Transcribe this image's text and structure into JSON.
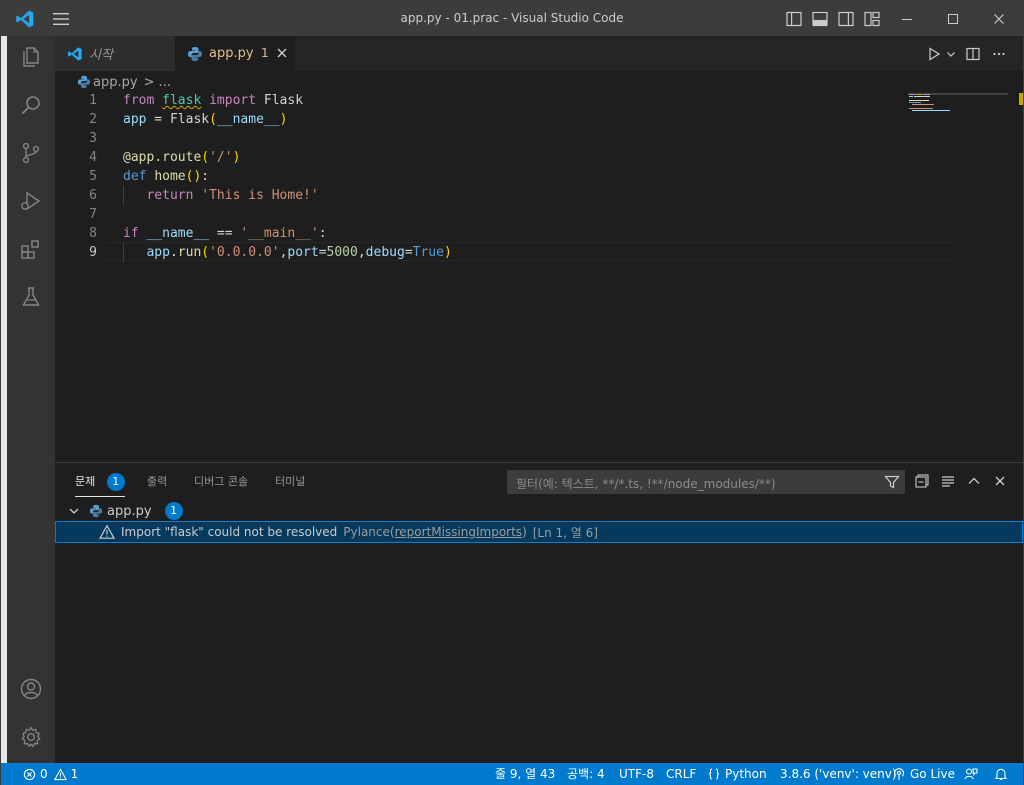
{
  "window": {
    "title": "app.py - 01.prac - Visual Studio Code"
  },
  "tabs": [
    {
      "label": "시작",
      "icon": "vscode-logo-icon"
    },
    {
      "label": "app.py",
      "icon": "python-icon",
      "problem_count": "1"
    }
  ],
  "breadcrumb": {
    "file": "app.py",
    "separator": ">",
    "more": "..."
  },
  "editor": {
    "current_line": 9,
    "lines": [
      {
        "no": "1"
      },
      {
        "no": "2"
      },
      {
        "no": "3"
      },
      {
        "no": "4"
      },
      {
        "no": "5"
      },
      {
        "no": "6"
      },
      {
        "no": "7"
      },
      {
        "no": "8"
      },
      {
        "no": "9"
      }
    ],
    "code": {
      "l1": {
        "from": "from",
        "module": "flask",
        "import": "import",
        "cls": "Flask"
      },
      "l2": {
        "var": "app",
        "eq": " = ",
        "cls": "Flask",
        "open": "(",
        "arg": "__name__",
        "close": ")"
      },
      "l4": {
        "at": "@",
        "obj": "app",
        "dot": ".",
        "fn": "route",
        "open": "(",
        "str": "'/'",
        "close": ")"
      },
      "l5": {
        "def": "def",
        "fn": "home",
        "parens": "()",
        "colon": ":"
      },
      "l6": {
        "ret": "return",
        "str": "'This is Home!'"
      },
      "l8": {
        "if": "if",
        "name": "__name__",
        "eq": " == ",
        "str": "'__main__'",
        "colon": ":"
      },
      "l9": {
        "obj": "app",
        "dot": ".",
        "fn": "run",
        "open": "(",
        "str": "'0.0.0.0'",
        "c1": ",",
        "k1": "port",
        "e1": "=",
        "num": "5000",
        "c2": ",",
        "k2": "debug",
        "e2": "=",
        "const": "True",
        "close": ")"
      }
    }
  },
  "panel": {
    "tabs": [
      {
        "label": "문제",
        "count": "1"
      },
      {
        "label": "출력"
      },
      {
        "label": "디버그 콘솔"
      },
      {
        "label": "터미널"
      }
    ],
    "filter_placeholder": "필터(예: 텍스트, **/*.ts, !**/node_modules/**)",
    "problems": {
      "file": "app.py",
      "file_count": "1",
      "items": [
        {
          "message": "Import \"flask\" could not be resolved",
          "source": "Pylance(",
          "rule": "reportMissingImports",
          "source_end": ")",
          "location": "[Ln 1, 열 6]"
        }
      ]
    }
  },
  "statusbar": {
    "errors": "0",
    "warnings": "1",
    "position": "줄 9, 열 43",
    "spaces": "공백: 4",
    "encoding": "UTF-8",
    "eol": "CRLF",
    "language": "Python",
    "interpreter": "3.8.6 ('venv': venv)",
    "live": "Go Live"
  },
  "colors": {
    "accent": "#007acc",
    "titlebar": "#3c3c3c",
    "activitybar": "#333333",
    "editor_bg": "#1e1e1e",
    "warning": "#cca700"
  }
}
